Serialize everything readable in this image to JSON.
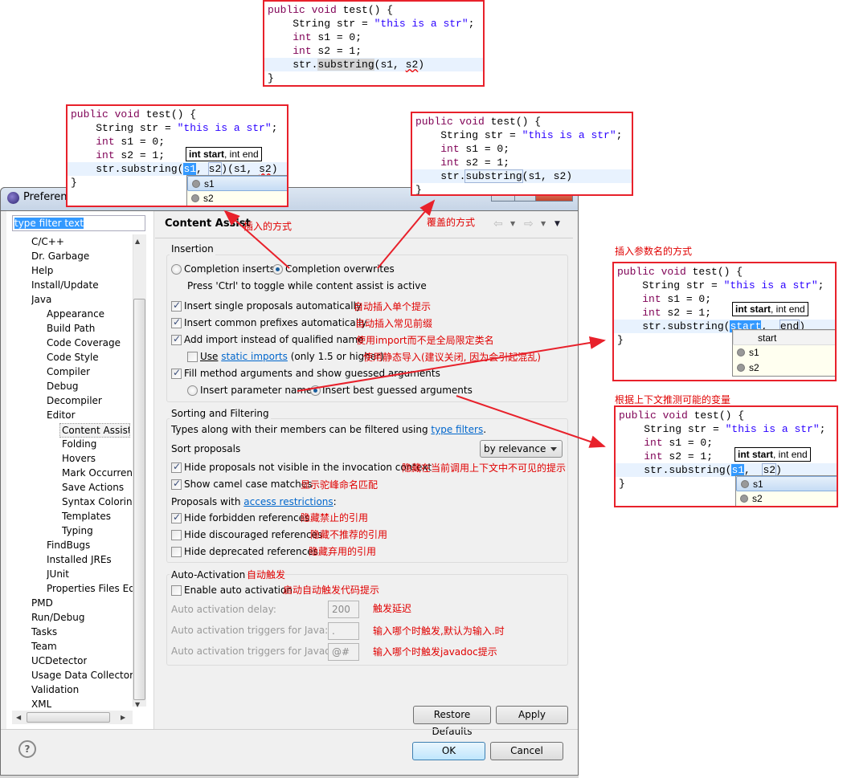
{
  "window": {
    "title": "Preferences",
    "title_visible": "Preferenc"
  },
  "filter": {
    "placeholder": "type filter text"
  },
  "tree": {
    "items": [
      {
        "label": "C/C++",
        "level": 0
      },
      {
        "label": "Dr. Garbage",
        "level": 0
      },
      {
        "label": "Help",
        "level": 0
      },
      {
        "label": "Install/Update",
        "level": 0
      },
      {
        "label": "Java",
        "level": 0
      },
      {
        "label": "Appearance",
        "level": 1
      },
      {
        "label": "Build Path",
        "level": 1
      },
      {
        "label": "Code Coverage",
        "level": 1
      },
      {
        "label": "Code Style",
        "level": 1
      },
      {
        "label": "Compiler",
        "level": 1
      },
      {
        "label": "Debug",
        "level": 1
      },
      {
        "label": "Decompiler",
        "level": 1
      },
      {
        "label": "Editor",
        "level": 1
      },
      {
        "label": "Content Assist",
        "level": 2,
        "selected": true
      },
      {
        "label": "Folding",
        "level": 2
      },
      {
        "label": "Hovers",
        "level": 2
      },
      {
        "label": "Mark Occurrences",
        "level": 2
      },
      {
        "label": "Save Actions",
        "level": 2
      },
      {
        "label": "Syntax Coloring",
        "level": 2
      },
      {
        "label": "Templates",
        "level": 2
      },
      {
        "label": "Typing",
        "level": 2
      },
      {
        "label": "FindBugs",
        "level": 1
      },
      {
        "label": "Installed JREs",
        "level": 1
      },
      {
        "label": "JUnit",
        "level": 1
      },
      {
        "label": "Properties Files Editor",
        "level": 1
      },
      {
        "label": "PMD",
        "level": 0
      },
      {
        "label": "Run/Debug",
        "level": 0
      },
      {
        "label": "Tasks",
        "level": 0
      },
      {
        "label": "Team",
        "level": 0
      },
      {
        "label": "UCDetector",
        "level": 0
      },
      {
        "label": "Usage Data Collector",
        "level": 0
      },
      {
        "label": "Validation",
        "level": 0
      },
      {
        "label": "XML",
        "level": 0
      }
    ]
  },
  "page": {
    "title": "Content Assist",
    "insertion": {
      "legend": "Insertion",
      "completion_inserts": "Completion inserts",
      "completion_overwrites": "Completion overwrites",
      "completion_mode": "overwrites",
      "ctrl_hint": "Press 'Ctrl' to toggle while content assist is active",
      "insert_single": {
        "label": "Insert single proposals automatically",
        "checked": true
      },
      "insert_common": {
        "label": "Insert common prefixes automatically",
        "checked": true
      },
      "add_import": {
        "label": "Add import instead of qualified name",
        "checked": true
      },
      "static_imports": {
        "prefix": "Use",
        "link": "static imports",
        "suffix": "(only 1.5 or higher)",
        "checked": false
      },
      "fill_args": {
        "label": "Fill method arguments and show guessed arguments",
        "checked": true
      },
      "insert_param_names": "Insert parameter names",
      "insert_best_guessed": "Insert best guessed arguments",
      "fill_mode": "best_guessed"
    },
    "sorting": {
      "legend": "Sorting and Filtering",
      "types_prefix": "Types along with their members can be filtered using",
      "types_link": "type filters",
      "types_suffix": ".",
      "sort_label": "Sort proposals",
      "sort_value": "by relevance",
      "hide_not_visible": {
        "label": "Hide proposals not visible in the invocation context",
        "checked": true
      },
      "camel_case": {
        "label": "Show camel case matches",
        "checked": true
      },
      "access_prefix": "Proposals with",
      "access_link": "access restrictions",
      "access_suffix": ":",
      "hide_forbidden": {
        "label": "Hide forbidden references",
        "checked": true
      },
      "hide_discouraged": {
        "label": "Hide discouraged references",
        "checked": false
      },
      "hide_deprecated": {
        "label": "Hide deprecated references",
        "checked": false
      }
    },
    "auto": {
      "legend": "Auto-Activation",
      "enable": {
        "label": "Enable auto activation",
        "checked": false
      },
      "delay_label": "Auto activation delay:",
      "delay_value": "200",
      "java_label": "Auto activation triggers for Java:",
      "java_value": ".",
      "javadoc_label": "Auto activation triggers for Javadoc:",
      "javadoc_value": "@#"
    },
    "restore_defaults": "Restore Defaults",
    "apply": "Apply"
  },
  "footer": {
    "ok": "OK",
    "cancel": "Cancel"
  },
  "annotations": {
    "insert_mode": "插入的方式",
    "overwrite_mode": "覆盖的方式",
    "insert_single": "自动插入单个提示",
    "insert_common": "自动插入常见前缀",
    "add_import": "使用import而不是全局限定类名",
    "static_imports": "使用静态导入(建议关闭, 因为会引起混乱)",
    "hide_not_visible": "隐藏在当前调用上下文中不可见的提示",
    "camel_case": "显示驼峰命名匹配",
    "hide_forbidden": "隐藏禁止的引用",
    "hide_discouraged": "隐藏不推荐的引用",
    "hide_deprecated": "隐藏弃用的引用",
    "auto_activation": "自动触发",
    "enable_auto": "启动自动触发代码提示",
    "delay": "触发延迟",
    "java_triggers": "输入哪个时触发,默认为输入.时",
    "javadoc_triggers": "输入哪个时触发javadoc提示",
    "param_names_caption": "插入参数名的方式",
    "guessed_caption": "根据上下文推测可能的变量"
  },
  "code_examples": {
    "header": [
      [
        [
          "public void test() {",
          "kw1"
        ]
      ],
      [
        [
          "    String str = ",
          ""
        ],
        [
          "\"this is a str\"",
          "str"
        ],
        [
          ";",
          ""
        ]
      ],
      [
        [
          "    ",
          ""
        ],
        [
          "int",
          "kw"
        ],
        [
          " s1 = 0;",
          ""
        ]
      ],
      [
        [
          "    ",
          ""
        ],
        [
          "int",
          "kw"
        ],
        [
          " s2 = 1;",
          ""
        ]
      ]
    ],
    "overwrite_result": {
      "line5": [
        [
          "    str.",
          ""
        ],
        [
          "substring",
          "mark"
        ],
        [
          "(s1, ",
          ""
        ],
        [
          "s2",
          "sq"
        ],
        [
          ")",
          ""
        ]
      ]
    },
    "insert_result": {
      "line5": [
        [
          "    str.substring(",
          ""
        ],
        [
          "s1",
          "selbox"
        ],
        [
          ", ",
          ""
        ],
        [
          "s2",
          "lnk"
        ],
        [
          ")(s1, ",
          ""
        ],
        [
          "s2",
          "sq"
        ],
        [
          ")",
          ""
        ]
      ]
    },
    "overwrite_example": {
      "line5": [
        [
          "    str.",
          ""
        ],
        [
          "substring",
          "lnk"
        ],
        [
          "(s1, s2)",
          ""
        ]
      ]
    },
    "param_names_example": {
      "line5": [
        [
          "    str.substring(",
          ""
        ],
        [
          "start",
          "selbox"
        ],
        [
          ",  ",
          ""
        ],
        [
          "end",
          "lnk"
        ],
        [
          ")",
          ""
        ]
      ]
    },
    "guessed_example": {
      "line5": [
        [
          "    str.substring(",
          ""
        ],
        [
          "s1",
          "selbox"
        ],
        [
          ",  ",
          ""
        ],
        [
          "s2",
          "lnk"
        ],
        [
          ")",
          ""
        ]
      ]
    },
    "closing": "}",
    "tooltip_bold": "int start",
    "tooltip_rest": ", int end",
    "popup_header": "start",
    "proposals": [
      "s1",
      "s2"
    ]
  }
}
